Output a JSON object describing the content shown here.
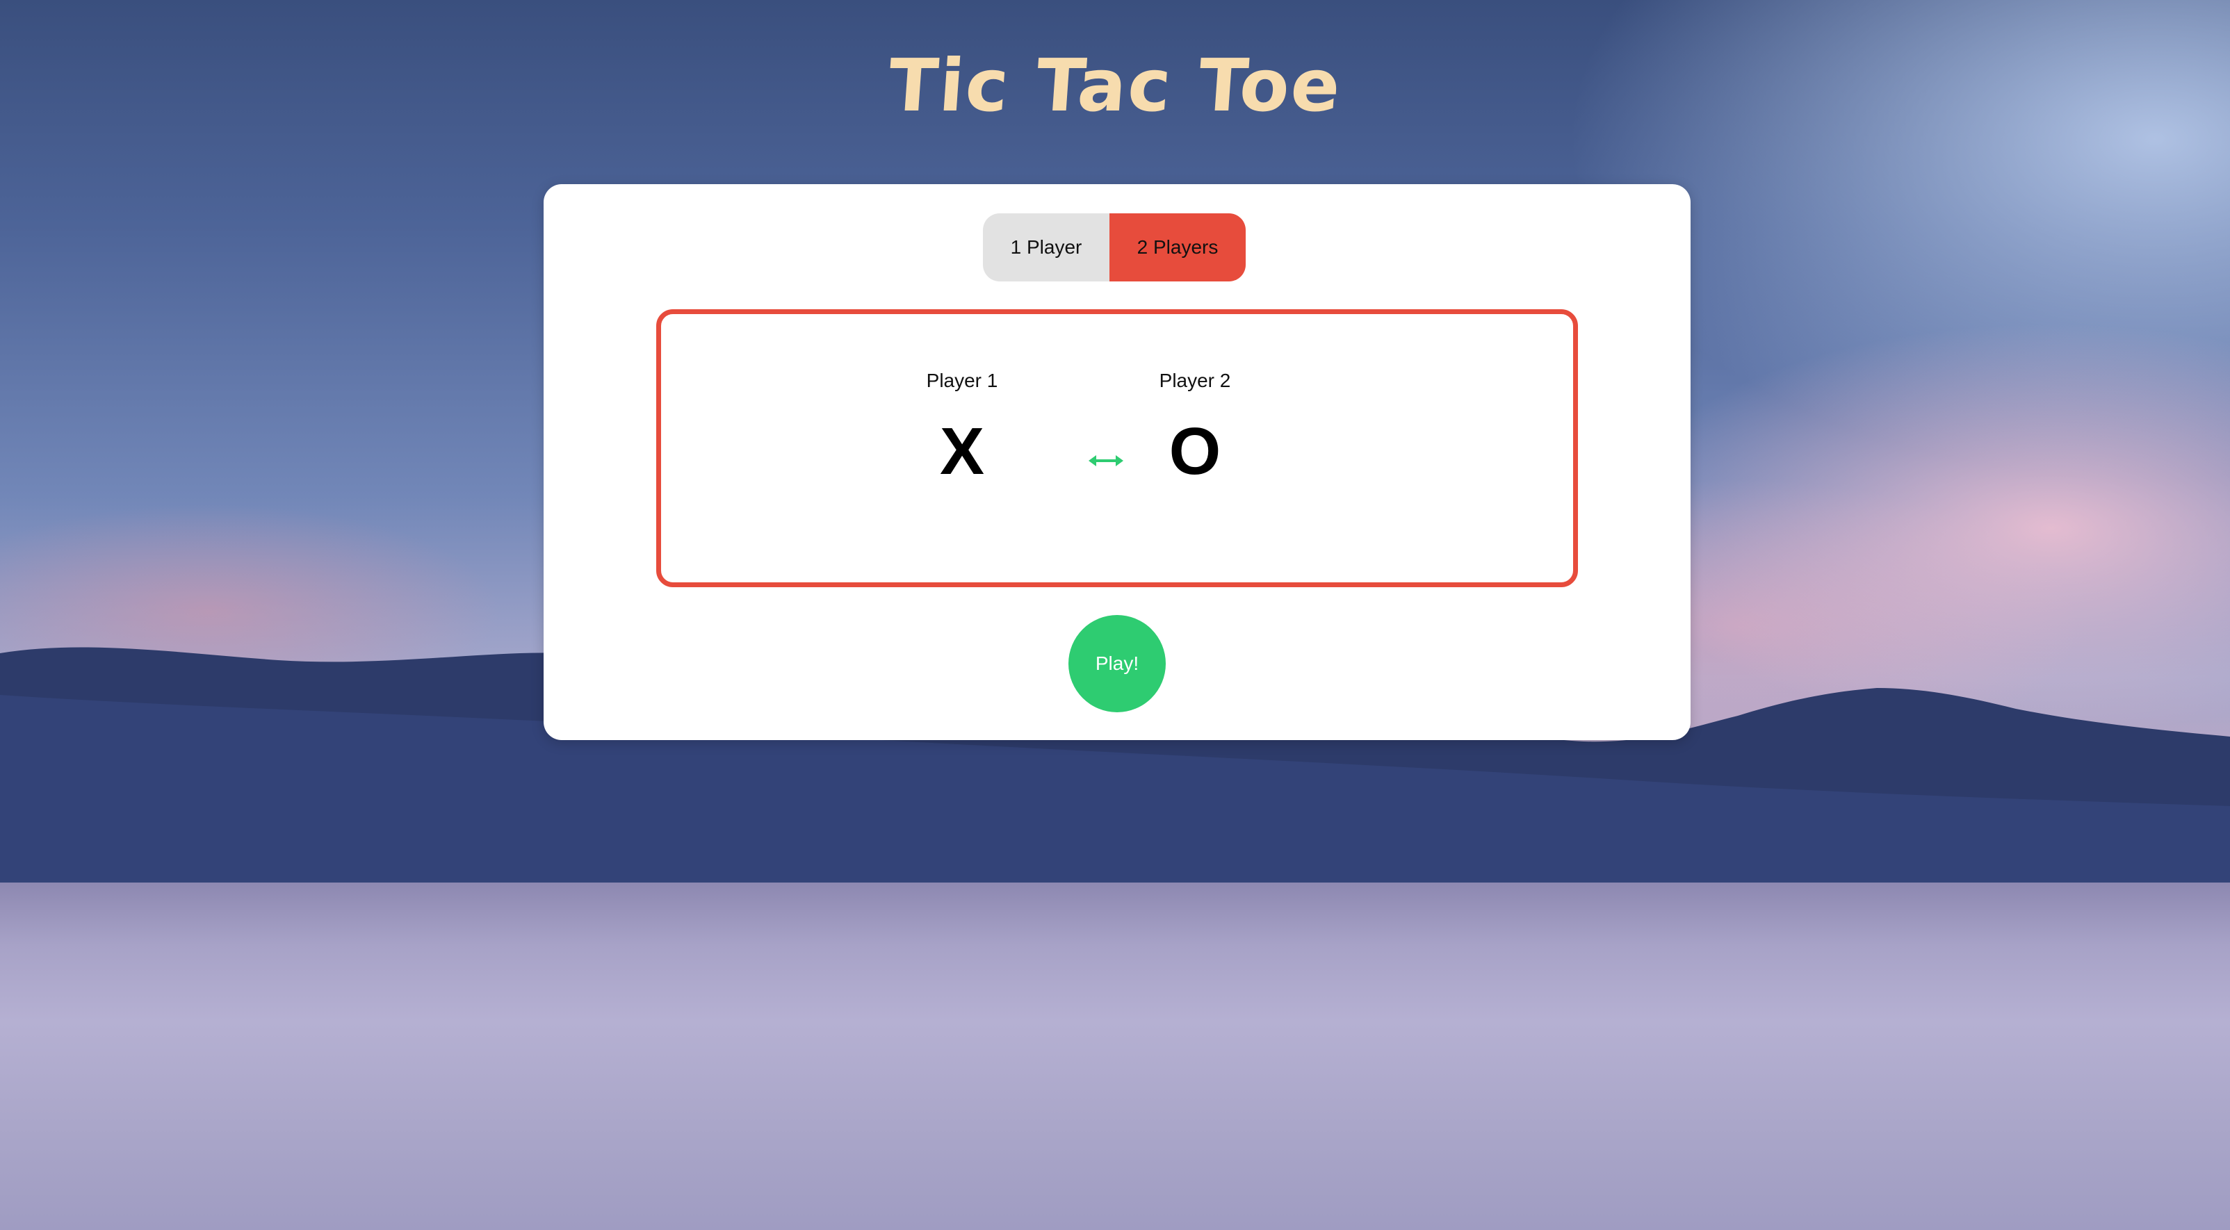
{
  "app": {
    "title": "Tic Tac Toe"
  },
  "mode": {
    "one_player_label": "1 Player",
    "two_players_label": "2 Players",
    "selected": "2 Players"
  },
  "players": {
    "player1": {
      "label": "Player 1",
      "symbol": "X"
    },
    "player2": {
      "label": "Player 2",
      "symbol": "O"
    },
    "swap_icon": "swap-arrows-icon"
  },
  "actions": {
    "play_label": "Play!"
  },
  "colors": {
    "title": "#f7dcae",
    "accent_red": "#e74c3c",
    "play_green": "#2ecc71",
    "toggle_inactive": "#e2e2e2",
    "card": "#ffffff"
  }
}
